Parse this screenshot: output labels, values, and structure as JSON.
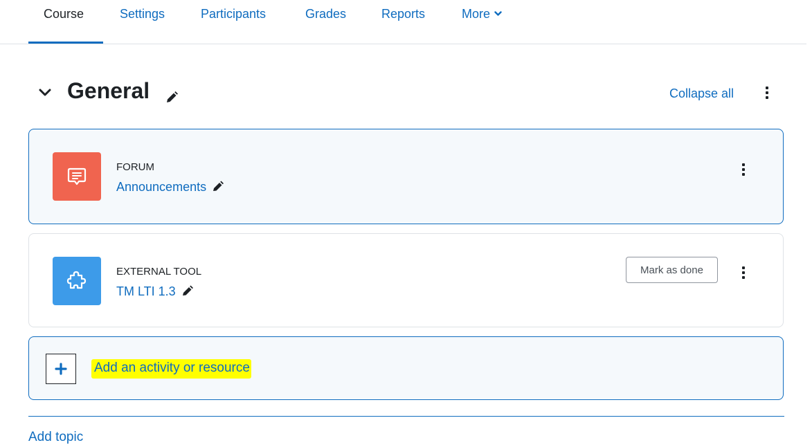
{
  "nav": {
    "tabs": [
      {
        "label": "Course",
        "active": true
      },
      {
        "label": "Settings"
      },
      {
        "label": "Participants"
      },
      {
        "label": "Grades"
      },
      {
        "label": "Reports"
      },
      {
        "label": "More"
      }
    ]
  },
  "section": {
    "title": "General",
    "collapse_all": "Collapse all"
  },
  "activities": [
    {
      "type": "FORUM",
      "name": "Announcements",
      "icon": "forum-icon",
      "color": "#f0644f"
    },
    {
      "type": "EXTERNAL TOOL",
      "name": "TM LTI 1.3",
      "icon": "puzzle-icon",
      "color": "#3d9be9",
      "completion_button": "Mark as done"
    }
  ],
  "add_activity": {
    "label": "Add an activity or resource"
  },
  "add_topic": {
    "label": "Add topic"
  },
  "colors": {
    "link": "#0f6cbf",
    "highlight": "#ffff00",
    "text": "#1d2125"
  }
}
